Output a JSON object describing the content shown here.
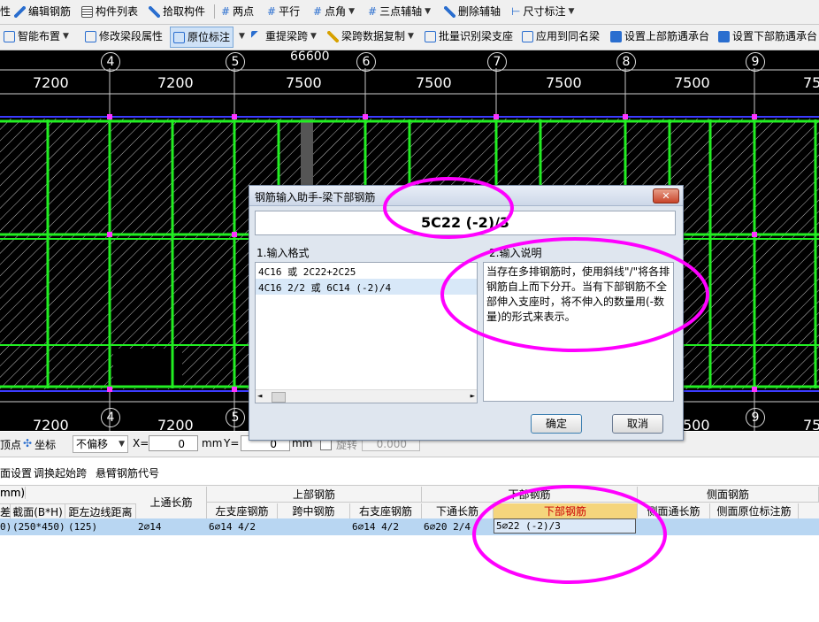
{
  "toolbar1": {
    "items": [
      "性",
      "编辑钢筋",
      "构件列表",
      "拾取构件",
      "两点",
      "平行",
      "点角",
      "三点辅轴",
      "删除辅轴",
      "尺寸标注"
    ]
  },
  "toolbar2": {
    "items": [
      "智能布置",
      "修改梁段属性",
      "原位标注",
      "重提梁跨",
      "梁跨数据复制",
      "批量识别梁支座",
      "应用到同名梁",
      "设置上部筋遇承台",
      "设置下部筋遇承台"
    ]
  },
  "canvas": {
    "total_dim": "66600",
    "axis_labels_top": [
      "4",
      "5",
      "6",
      "7",
      "8",
      "9"
    ],
    "axis_labels_bottom": [
      "4",
      "5",
      "9"
    ],
    "span_dims_top": [
      "7200",
      "7200",
      "7500",
      "7500",
      "7500",
      "7500",
      "75"
    ],
    "span_dims_bottom": [
      "7200",
      "7200",
      "500",
      "75"
    ]
  },
  "dialog": {
    "title": "钢筋输入助手-梁下部钢筋",
    "close_glyph": "✕",
    "input_value": "5C22 (-2)/3",
    "format_header": "1.输入格式",
    "format_items": [
      "4C16 或 2C22+2C25",
      "4C16 2/2 或 6C14 (-2)/4"
    ],
    "desc_header": "2.输入说明",
    "desc_text": "当存在多排钢筋时，使用斜线\"/\"将各排钢筋自上而下分开。当有下部钢筋不全部伸入支座时，将不伸入的数量用(-数量)的形式来表示。",
    "ok_label": "确定",
    "cancel_label": "取消"
  },
  "statusbar": {
    "snap_label": "顶点",
    "coord_label": "坐标",
    "offset_select": "不偏移",
    "x_label": "X=",
    "x_value": "0",
    "mm1": "mm",
    "y_label": "Y=",
    "y_value": "0",
    "mm2": "mm",
    "rotate_label": "旋转",
    "rotate_value": "0.000",
    "degree": "°"
  },
  "subtoolbar": {
    "items": [
      "面设置",
      "调换起始跨",
      "悬臂钢筋代号"
    ]
  },
  "table": {
    "group_headers": {
      "left_unit": "mm)",
      "top": "上部钢筋",
      "bottom": "下部钢筋",
      "side": "侧面钢筋"
    },
    "columns": [
      "差",
      "截面(B*H)",
      "距左边线距离",
      "上通长筋",
      "左支座钢筋",
      "跨中钢筋",
      "右支座钢筋",
      "下通长筋",
      "下部钢筋",
      "侧面通长筋",
      "侧面原位标注筋"
    ],
    "row": [
      "0)",
      "(250*450)",
      "(125)",
      "2⌀14",
      "6⌀14 4/2",
      "",
      "6⌀14 4/2",
      "6⌀20 2/4",
      "5⌀22 (-2)/3",
      "",
      ""
    ]
  },
  "colors": {
    "toolbar_bg": "#f0f0f0",
    "canvas_bg": "#000000",
    "beam_green": "#22ee22",
    "grid_line": "#c8c8c8",
    "magenta_annotation": "#ff00ff",
    "dim_text": "#ffffff",
    "selected_row": "#b8d6f2",
    "active_header": "#f5d57c",
    "active_text": "#cc0000"
  }
}
